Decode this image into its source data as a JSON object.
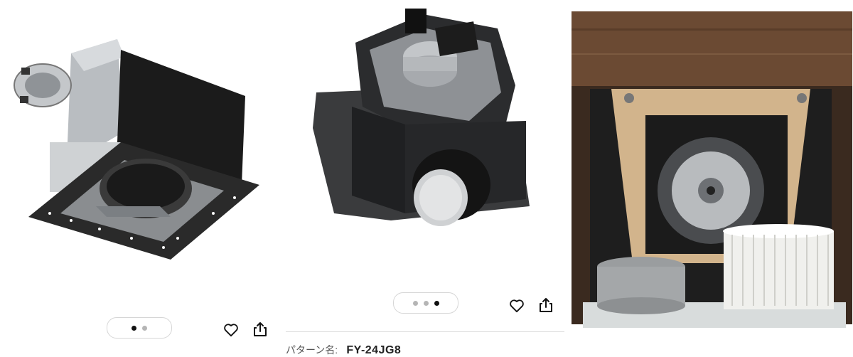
{
  "product": {
    "images": [
      {
        "icon": "exhaust-fan-box-image"
      },
      {
        "icon": "fan-motor-unit-image"
      },
      {
        "icon": "ceiling-installed-fan-image"
      }
    ]
  },
  "carousel_left": {
    "dots": 2,
    "active_index": 0
  },
  "carousel_middle": {
    "dots": 3,
    "active_index": 2
  },
  "actions": {
    "favorite_icon": "heart-icon",
    "share_icon": "share-icon"
  },
  "pattern": {
    "label": "パターン名:",
    "value": "FY-24JG8"
  }
}
